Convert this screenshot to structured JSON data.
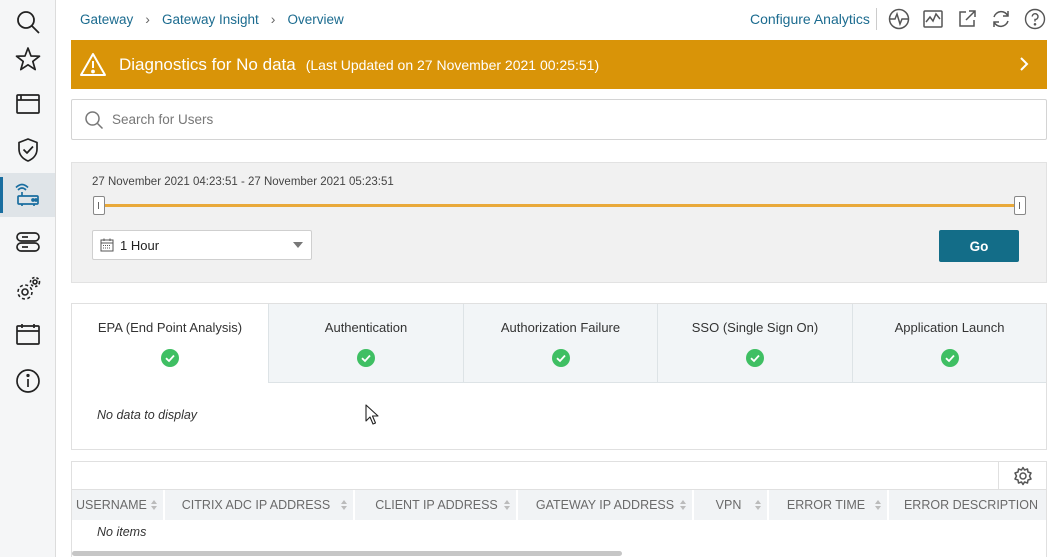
{
  "sidebar": {
    "items": [
      {
        "icon": "search-icon"
      },
      {
        "icon": "star-icon"
      },
      {
        "icon": "browser-window-icon"
      },
      {
        "icon": "shield-check-icon"
      },
      {
        "icon": "gateway-icon",
        "active": true
      },
      {
        "icon": "server-stack-icon"
      },
      {
        "icon": "settings-gears-icon"
      },
      {
        "icon": "calendar-window-icon"
      },
      {
        "icon": "info-icon"
      }
    ]
  },
  "header": {
    "breadcrumbs": [
      "Gateway",
      "Gateway Insight",
      "Overview"
    ],
    "configure_label": "Configure Analytics",
    "icons": [
      "pulse-icon",
      "monitor-chart-icon",
      "external-link-icon",
      "refresh-icon",
      "help-icon"
    ]
  },
  "banner": {
    "title": "Diagnostics for No data",
    "updated": "(Last Updated on 27 November 2021 00:25:51)",
    "color": "#d99408"
  },
  "search": {
    "placeholder": "Search for Users",
    "value": ""
  },
  "timerange": {
    "label": "27 November 2021 04:23:51 - 27 November 2021 05:23:51",
    "slider_start_fraction": 0,
    "slider_end_fraction": 1,
    "duration_value": "1 Hour",
    "go_label": "Go",
    "accent": "#e9a93a",
    "button_color": "#136d88"
  },
  "tabs": [
    {
      "label": "EPA (End Point Analysis)",
      "status": "ok",
      "active": true
    },
    {
      "label": "Authentication",
      "status": "ok",
      "active": false
    },
    {
      "label": "Authorization Failure",
      "status": "ok",
      "active": false
    },
    {
      "label": "SSO (Single Sign On)",
      "status": "ok",
      "active": false
    },
    {
      "label": "Application Launch",
      "status": "ok",
      "active": false
    }
  ],
  "tab_content": {
    "message": "No data to display"
  },
  "table": {
    "columns": [
      "USERNAME",
      "CITRIX ADC IP ADDRESS",
      "CLIENT IP ADDRESS",
      "GATEWAY IP ADDRESS",
      "VPN",
      "ERROR TIME",
      "ERROR DESCRIPTION"
    ],
    "empty_message": "No items"
  },
  "colors": {
    "link": "#1b6b8f",
    "success": "#3fbf63"
  }
}
